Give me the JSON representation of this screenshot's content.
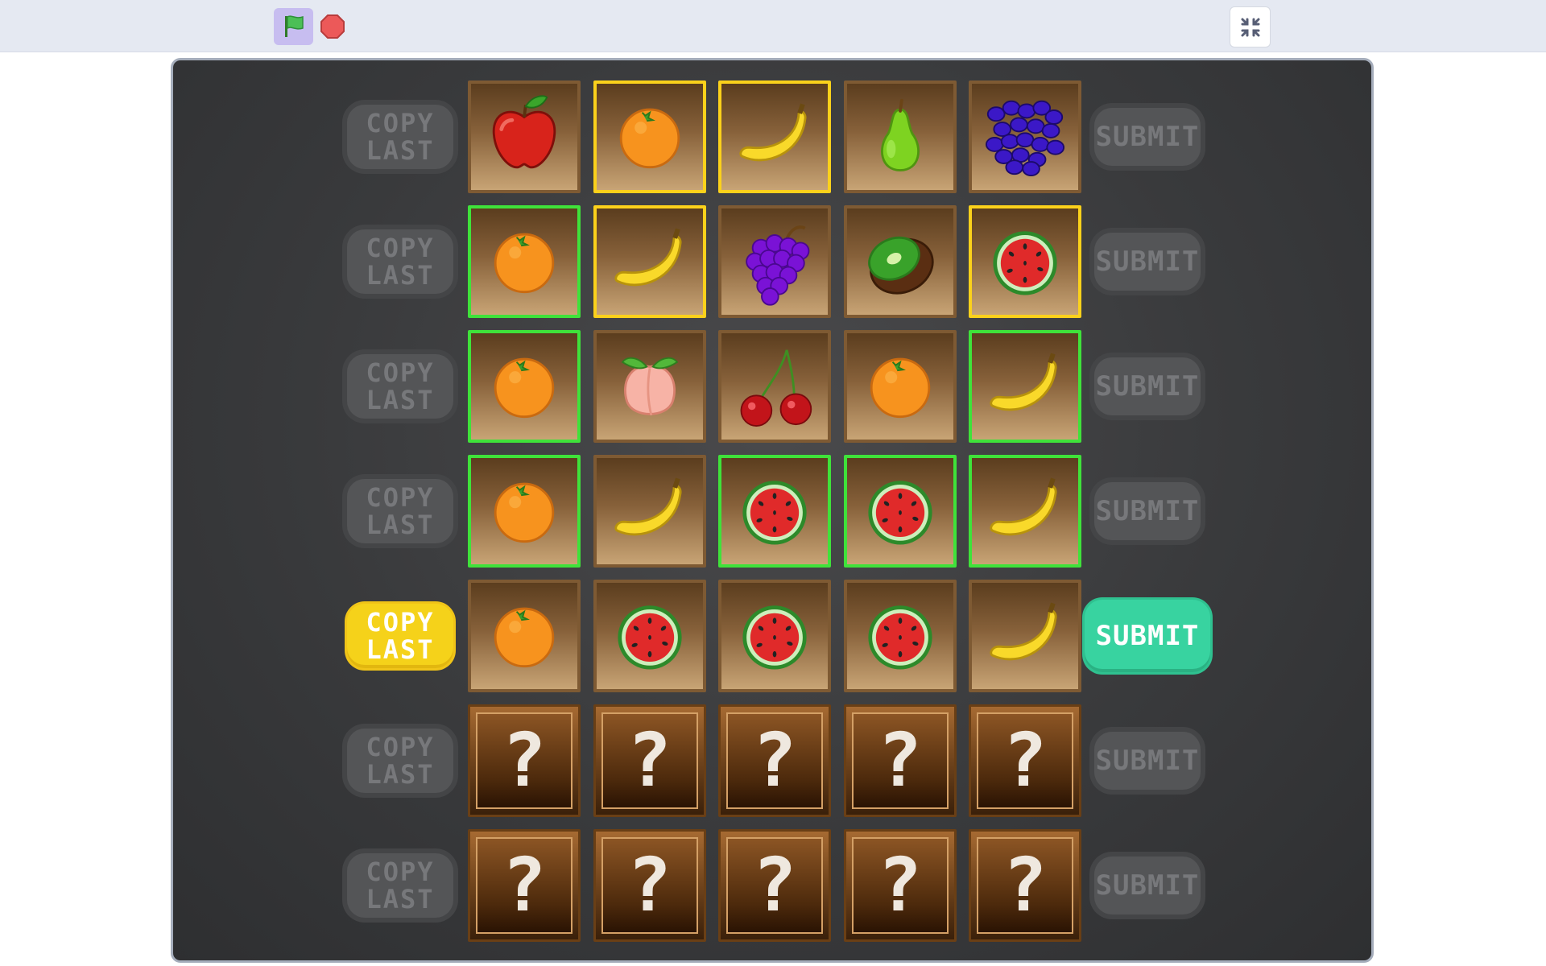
{
  "toolbar": {
    "green_flag_icon": "green-flag-icon",
    "stop_icon": "stop-sign-icon",
    "fullscreen_icon": "exit-fullscreen-icon"
  },
  "colors": {
    "stage_bg": "#3a3b3d",
    "copy_active": "#f5d21a",
    "submit_active": "#38d3a0",
    "tile_border_yellow": "#fbd11b",
    "tile_border_green": "#3fe23a",
    "inactive_button": "#545557"
  },
  "game": {
    "hidden_symbol": "?",
    "rows": [
      {
        "copy_label": "COPY\nLAST",
        "submit_label": "SUBMIT",
        "active": false,
        "cells": [
          {
            "fruit": "apple",
            "mark": "none"
          },
          {
            "fruit": "orange",
            "mark": "yellow"
          },
          {
            "fruit": "banana",
            "mark": "yellow"
          },
          {
            "fruit": "pear",
            "mark": "none"
          },
          {
            "fruit": "blueberries",
            "mark": "none"
          }
        ]
      },
      {
        "copy_label": "COPY\nLAST",
        "submit_label": "SUBMIT",
        "active": false,
        "cells": [
          {
            "fruit": "orange",
            "mark": "green"
          },
          {
            "fruit": "banana",
            "mark": "yellow"
          },
          {
            "fruit": "grapes",
            "mark": "none"
          },
          {
            "fruit": "kiwi",
            "mark": "none"
          },
          {
            "fruit": "watermelon",
            "mark": "yellow"
          }
        ]
      },
      {
        "copy_label": "COPY\nLAST",
        "submit_label": "SUBMIT",
        "active": false,
        "cells": [
          {
            "fruit": "orange",
            "mark": "green"
          },
          {
            "fruit": "peach",
            "mark": "none"
          },
          {
            "fruit": "cherries",
            "mark": "none"
          },
          {
            "fruit": "orange",
            "mark": "none"
          },
          {
            "fruit": "banana",
            "mark": "green"
          }
        ]
      },
      {
        "copy_label": "COPY\nLAST",
        "submit_label": "SUBMIT",
        "active": false,
        "cells": [
          {
            "fruit": "orange",
            "mark": "green"
          },
          {
            "fruit": "banana",
            "mark": "none"
          },
          {
            "fruit": "watermelon",
            "mark": "green"
          },
          {
            "fruit": "watermelon",
            "mark": "green"
          },
          {
            "fruit": "banana",
            "mark": "green"
          }
        ]
      },
      {
        "copy_label": "COPY\nLAST",
        "submit_label": "SUBMIT",
        "active": true,
        "cells": [
          {
            "fruit": "orange",
            "mark": "none"
          },
          {
            "fruit": "watermelon",
            "mark": "none"
          },
          {
            "fruit": "watermelon",
            "mark": "none"
          },
          {
            "fruit": "watermelon",
            "mark": "none"
          },
          {
            "fruit": "banana",
            "mark": "none"
          }
        ]
      },
      {
        "copy_label": "COPY\nLAST",
        "submit_label": "SUBMIT",
        "active": false,
        "cells": [
          {
            "fruit": "hidden",
            "mark": "none"
          },
          {
            "fruit": "hidden",
            "mark": "none"
          },
          {
            "fruit": "hidden",
            "mark": "none"
          },
          {
            "fruit": "hidden",
            "mark": "none"
          },
          {
            "fruit": "hidden",
            "mark": "none"
          }
        ]
      },
      {
        "copy_label": "COPY\nLAST",
        "submit_label": "SUBMIT",
        "active": false,
        "cells": [
          {
            "fruit": "hidden",
            "mark": "none"
          },
          {
            "fruit": "hidden",
            "mark": "none"
          },
          {
            "fruit": "hidden",
            "mark": "none"
          },
          {
            "fruit": "hidden",
            "mark": "none"
          },
          {
            "fruit": "hidden",
            "mark": "none"
          }
        ]
      }
    ]
  }
}
